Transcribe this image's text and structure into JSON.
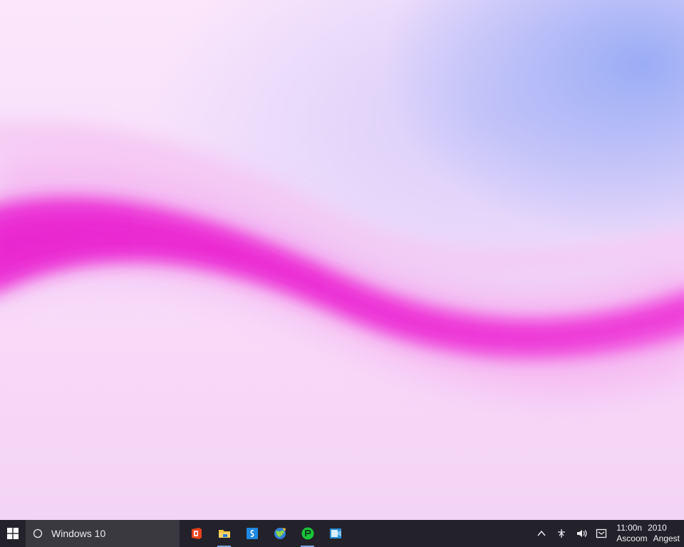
{
  "taskbar": {
    "start_icon": "windows-logo-icon",
    "search": {
      "icon": "search-circle-icon",
      "text": "Windows 10"
    },
    "apps": [
      {
        "name": "office-app",
        "icon": "office-icon",
        "color": "#e8431d",
        "active": false
      },
      {
        "name": "file-explorer-app",
        "icon": "folder-icon",
        "color": "#f4c542",
        "active": true
      },
      {
        "name": "store-app",
        "icon": "store-icon",
        "color": "#1e88e5",
        "active": false
      },
      {
        "name": "browser-app",
        "icon": "globe-icon",
        "color": "#2f7fd6",
        "active": false
      },
      {
        "name": "green-app",
        "icon": "green-circle-icon",
        "color": "#19c43a",
        "active": true
      },
      {
        "name": "mail-app",
        "icon": "mail-icon",
        "color": "#2a8fd8",
        "active": false
      }
    ],
    "tray": {
      "icons": [
        "chevron-up-icon",
        "network-icon",
        "volume-icon",
        "message-icon"
      ]
    },
    "clock": {
      "time": "11:00n",
      "date": "2010",
      "line2_left": "Ascoom",
      "line2_right": "Angest"
    }
  },
  "colors": {
    "taskbar_bg": "#23222a",
    "search_bg": "#3a3940",
    "wave_accent": "#ee2bd6",
    "sky_blue": "#a7b7f4"
  }
}
